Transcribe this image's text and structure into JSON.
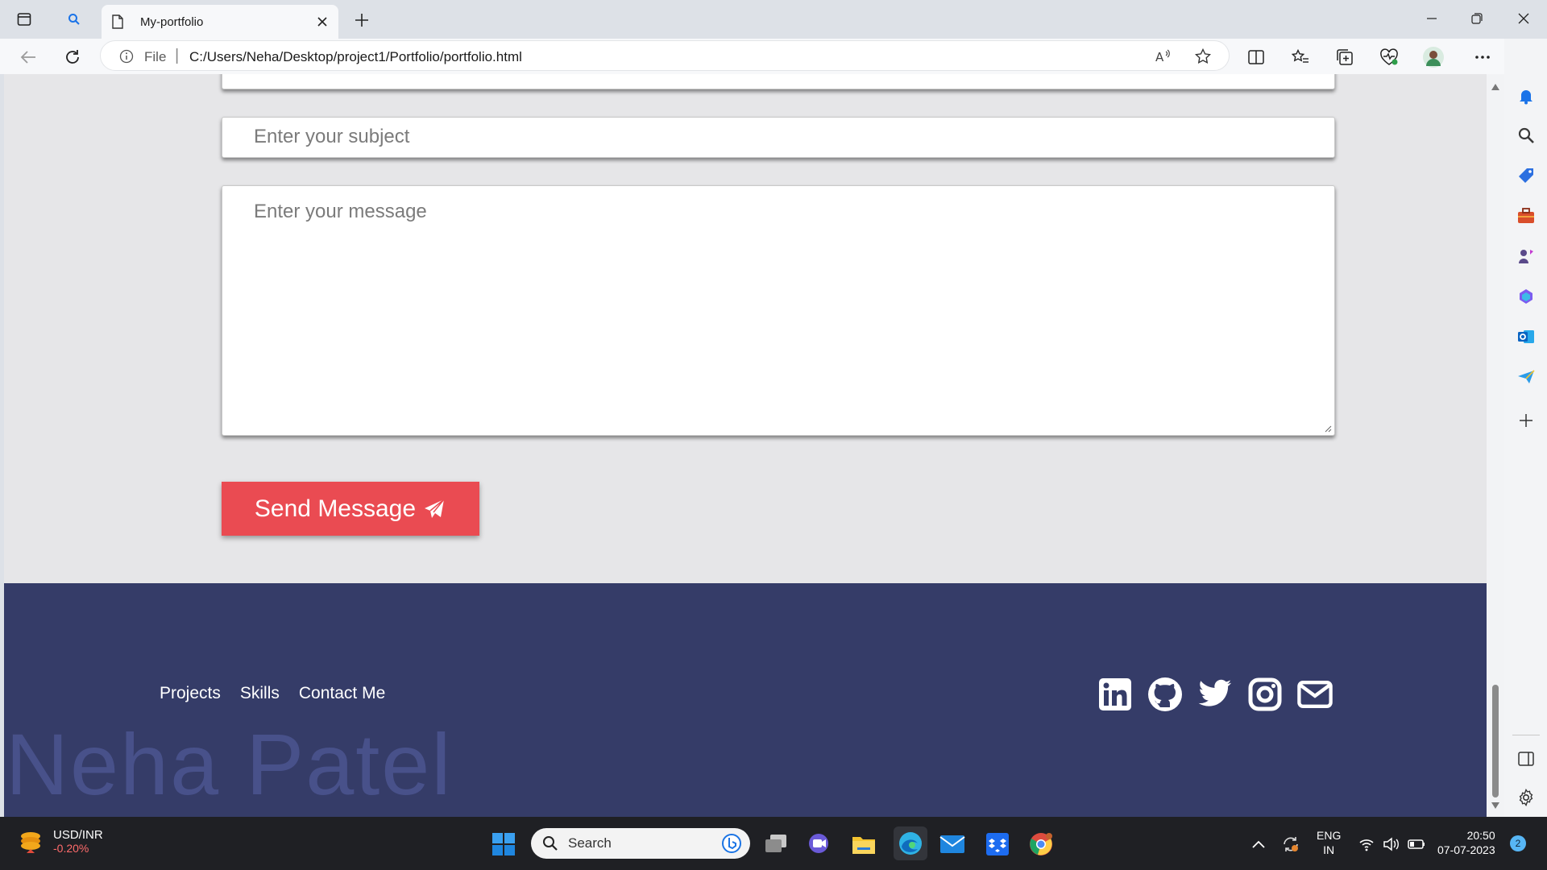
{
  "browser": {
    "tab_title": "My-portfolio",
    "address_scheme": "File",
    "address_separator": "|",
    "url": "C:/Users/Neha/Desktop/project1/Portfolio/portfolio.html"
  },
  "form": {
    "subject_placeholder": "Enter your subject",
    "message_placeholder": "Enter your message",
    "send_label": "Send Message"
  },
  "footer": {
    "links": [
      "Projects",
      "Skills",
      "Contact Me"
    ],
    "brand": "Neha Patel",
    "socials": [
      "linkedin-icon",
      "github-icon",
      "twitter-icon",
      "instagram-icon",
      "mail-icon"
    ]
  },
  "taskbar": {
    "ticker_name": "USD/INR",
    "ticker_change": "-0.20%",
    "search_placeholder": "Search",
    "lang_line1": "ENG",
    "lang_line2": "IN",
    "time": "20:50",
    "date": "07-07-2023",
    "notification_count": "2"
  },
  "colors": {
    "accent_button": "#ea4b52",
    "footer_bg": "#353c68",
    "brand_text": "#48518a",
    "page_bg": "#e6e6e8"
  }
}
